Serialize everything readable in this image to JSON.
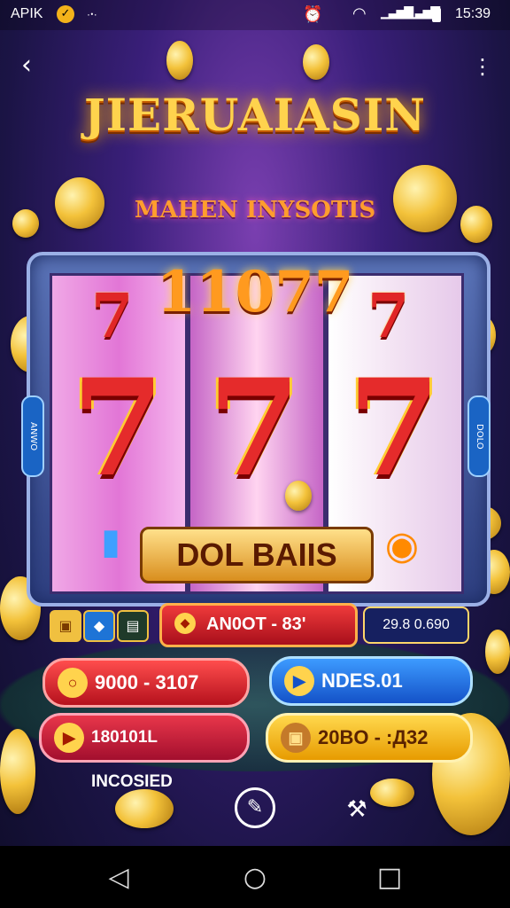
{
  "status_bar": {
    "carrier": "APIK",
    "extra": "·ꞏ·",
    "time": "15:39"
  },
  "header": {
    "back_icon": "chevron-left-icon",
    "menu_icon": "more-vertical-icon"
  },
  "title": "JIERUAIASIN",
  "subtitle": "MAHEN INYSOTIS",
  "slot_machine": {
    "jackpot_text": "11077",
    "reels": [
      {
        "top": "7",
        "main": "7"
      },
      {
        "top": "",
        "main": "7"
      },
      {
        "top": "7",
        "main": "7"
      }
    ],
    "left_side_label": "ANWO",
    "right_side_label": "DOLO",
    "spin_bar_label": "DOL BAIIS"
  },
  "info_row": {
    "center_value": "AN0OT - 83'",
    "right_value": "29.8 0.690"
  },
  "action_buttons": [
    {
      "label": "9000 - 3107",
      "icon": "coin-icon"
    },
    {
      "label": "NDES.01",
      "icon": "play-icon"
    },
    {
      "label": "180101L INCOSIED",
      "icon": "play-icon"
    },
    {
      "label": "20BO - :Д32",
      "icon": "chest-icon"
    }
  ],
  "colors": {
    "accent_gold": "#ffd34d",
    "red_button": "#d81f2e",
    "blue_button": "#2a7cf0"
  }
}
